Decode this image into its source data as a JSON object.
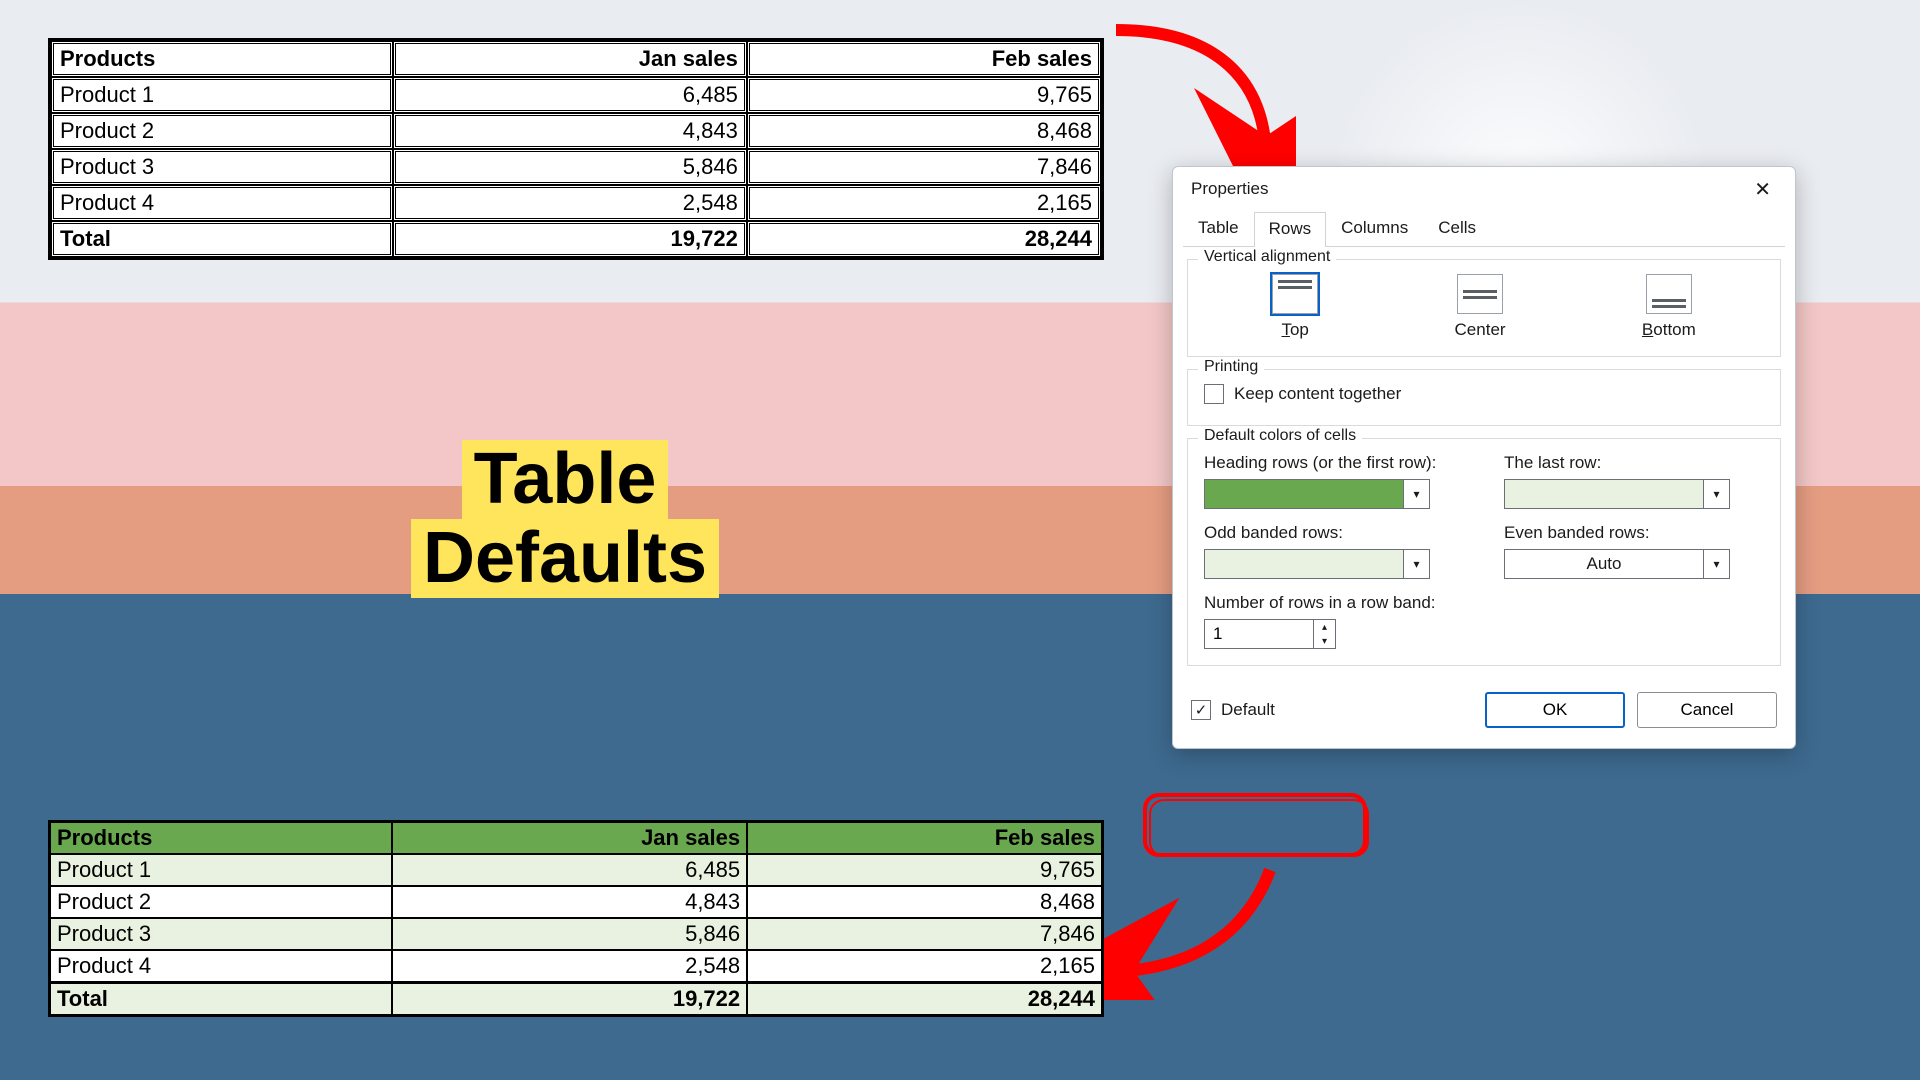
{
  "caption": {
    "line1": "Table",
    "line2": "Defaults"
  },
  "table": {
    "headers": [
      "Products",
      "Jan sales",
      "Feb sales"
    ],
    "rows": [
      {
        "p": "Product 1",
        "jan": "6,485",
        "feb": "9,765"
      },
      {
        "p": "Product 2",
        "jan": "4,843",
        "feb": "8,468"
      },
      {
        "p": "Product 3",
        "jan": "5,846",
        "feb": "7,846"
      },
      {
        "p": "Product 4",
        "jan": "2,548",
        "feb": "2,165"
      }
    ],
    "total": {
      "label": "Total",
      "jan": "19,722",
      "feb": "28,244"
    }
  },
  "dialog": {
    "title": "Properties",
    "tabs": [
      "Table",
      "Rows",
      "Columns",
      "Cells"
    ],
    "activeTab": "Rows",
    "valign": {
      "legend": "Vertical alignment",
      "options": {
        "top": "Top",
        "center": "Center",
        "bottom": "Bottom"
      },
      "selected": "top"
    },
    "printing": {
      "legend": "Printing",
      "keepTogether": "Keep content together"
    },
    "colors": {
      "legend": "Default colors of cells",
      "headingLabel": "Heading rows (or the first row):",
      "heading": "#6aa84f",
      "lastLabel": "The last row:",
      "last": "#e9f2e0",
      "oddLabel": "Odd banded rows:",
      "odd": "#e9f2e0",
      "evenLabel": "Even banded rows:",
      "evenAuto": "Auto",
      "numLabel": "Number of rows in a row band:",
      "num": "1"
    },
    "footer": {
      "default": "Default",
      "ok": "OK",
      "cancel": "Cancel"
    }
  },
  "chart_data": {
    "type": "table",
    "columns": [
      "Products",
      "Jan sales",
      "Feb sales"
    ],
    "rows": [
      [
        "Product 1",
        6485,
        9765
      ],
      [
        "Product 2",
        4843,
        8468
      ],
      [
        "Product 3",
        5846,
        7846
      ],
      [
        "Product 4",
        2548,
        2165
      ],
      [
        "Total",
        19722,
        28244
      ]
    ]
  }
}
